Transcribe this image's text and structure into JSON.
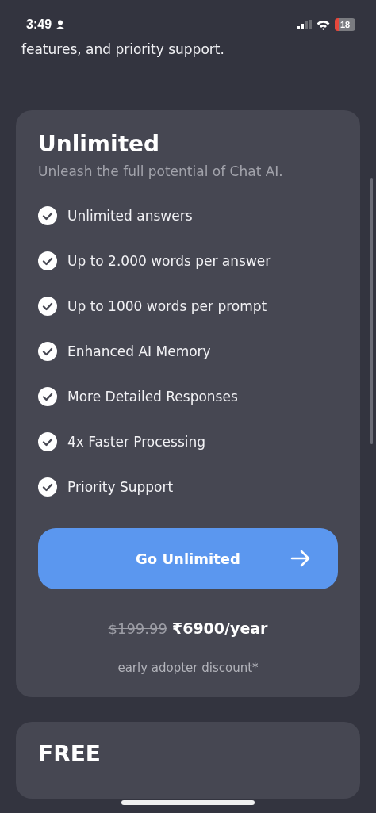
{
  "status_bar": {
    "time": "3:49",
    "battery": "18"
  },
  "intro_tail": "features, and priority support.",
  "plan": {
    "title": "Unlimited",
    "subtitle": "Unleash the full potential of Chat AI.",
    "features": [
      "Unlimited answers",
      "Up to 2.000 words per answer",
      "Up to 1000 words per prompt",
      "Enhanced AI Memory",
      "More Detailed Responses",
      "4x Faster Processing",
      "Priority Support"
    ],
    "button": "Go Unlimited",
    "old_price": "$199.99",
    "price": "₹6900/year",
    "note": "early adopter discount*"
  },
  "next_plan": {
    "title": "FREE"
  }
}
